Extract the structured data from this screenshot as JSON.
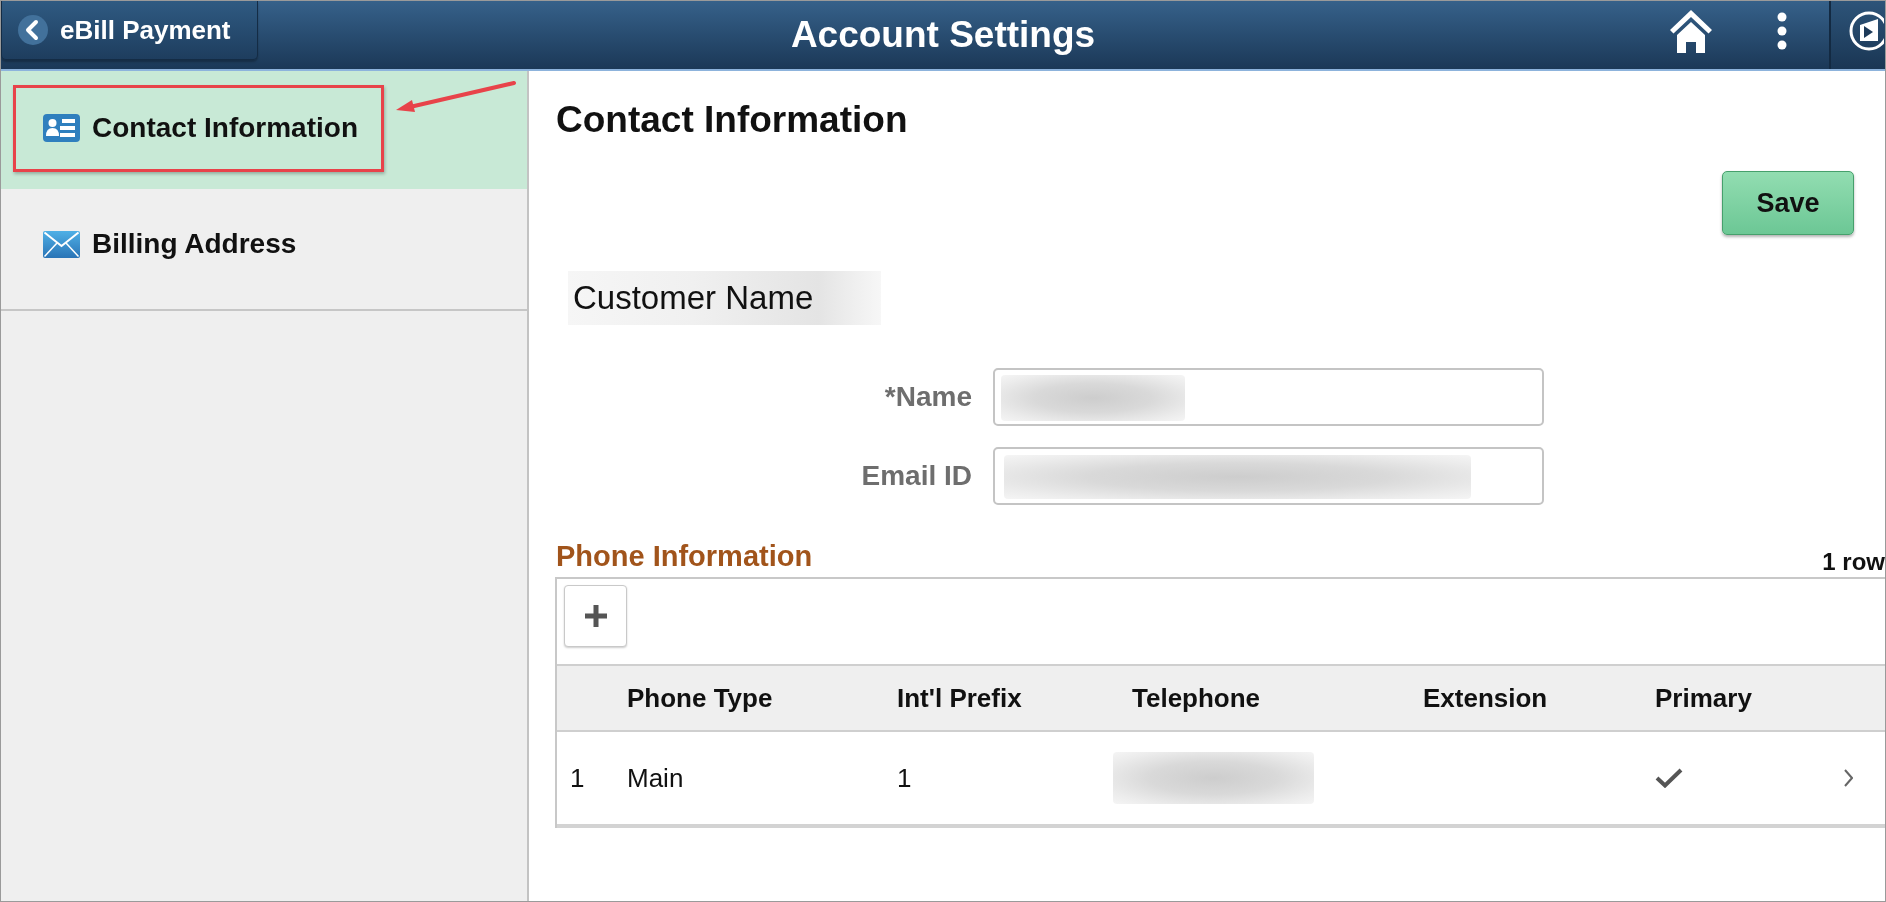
{
  "header": {
    "back_button": "eBill Payment",
    "title": "Account Settings"
  },
  "sidebar": {
    "items": [
      {
        "label": "Contact Information",
        "selected": true,
        "highlighted": true
      },
      {
        "label": "Billing Address",
        "selected": false,
        "highlighted": false
      }
    ]
  },
  "page": {
    "title": "Contact Information",
    "save_button": "Save",
    "section_heading": "Customer Name",
    "fields": [
      {
        "label": "*Name"
      },
      {
        "label": "Email ID"
      }
    ]
  },
  "phone_information": {
    "title": "Phone Information",
    "row_count": "1 row",
    "columns": [
      "Phone Type",
      "Int'l Prefix",
      "Telephone",
      "Extension",
      "Primary"
    ],
    "rows": [
      {
        "number": "1",
        "phone_type": "Main",
        "intl_prefix": "1",
        "primary": true
      }
    ]
  }
}
